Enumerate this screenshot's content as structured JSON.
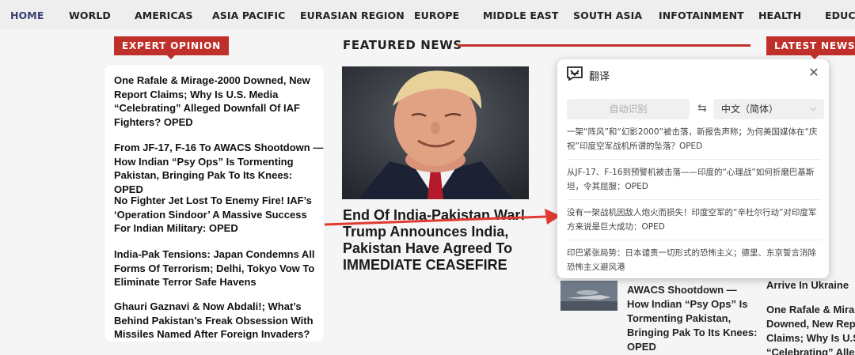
{
  "nav": {
    "items": [
      "HOME",
      "WORLD",
      "AMERICAS",
      "ASIA PACIFIC",
      "EURASIAN REGION",
      "EUROPE",
      "MIDDLE EAST",
      "SOUTH ASIA",
      "INFOTAINMENT",
      "HEALTH",
      "EDUCA"
    ]
  },
  "sections": {
    "expert_opinion": "EXPERT OPINION",
    "featured_news": "FEATURED NEWS",
    "latest_news": "LATEST NEWS"
  },
  "expert_opinion": [
    "One Rafale & Mirage-2000 Downed, New Report Claims; Why Is U.S. Media “Celebrating” Alleged Downfall Of IAF Fighters? OPED",
    "From JF-17, F-16 To AWACS Shootdown — How Indian “Psy Ops” Is Tormenting Pakistan, Bringing Pak To Its Knees: OPED",
    "No Fighter Jet Lost To Enemy Fire! IAF’s ‘Operation Sindoor’ A Massive Success For Indian Military: OPED",
    "India-Pak Tensions: Japan Condemns All Forms Of Terrorism; Delhi, Tokyo Vow To Eliminate Terror Safe Havens",
    "Ghauri Gaznavi & Now Abdali!; What’s Behind Pakistan’s Freak Obsession With Missiles Named After Foreign Invaders?"
  ],
  "featured": {
    "headline": "End Of India-Pakistan War! Trump Announces India, Pakistan Have Agreed To IMMEDIATE CEASEFIRE"
  },
  "mini_article": {
    "headline": "AWACS Shootdown — How Indian “Psy Ops” Is Tormenting Pakistan, Bringing Pak To Its Knees: OPED"
  },
  "latest_partial": [
    "late",
    "ders",
    "s ‘",
    "ear-",
    "Pak",
    "nce",
    "e Ag",
    "t Ai",
    "ys M",
    "arity",
    "s, Pa",
    "an Le",
    "Arrive In Ukraine",
    "One Rafale & Mira",
    "Downed, New Repo",
    "Claims; Why Is U.S",
    "“Celebrating” Alle"
  ],
  "translate": {
    "title": "翻译",
    "source_lang": "自动识别",
    "target_lang": "中文（简体）",
    "results": [
      "一架“阵风”和“幻影2000”被击落，新报告声称；为何美国媒体在“庆祝”印度空军战机所谓的坠落？OPED",
      "从JF-17、F-16到预警机被击落——印度的“心理战”如何折磨巴基斯坦，令其屈服：OPED",
      "没有一架战机因敌人炮火而损失！印度空军的“辛杜尔行动”对印度军方来说是巨大成功：OPED",
      "印巴紧张局势：日本谴责一切形式的恐怖主义；德里、东京誓言消除恐怖主义避风港"
    ]
  },
  "colors": {
    "accent_red": "#c0302a",
    "nav_bg": "#eeeeee",
    "nav_active": "#3a3f72"
  }
}
